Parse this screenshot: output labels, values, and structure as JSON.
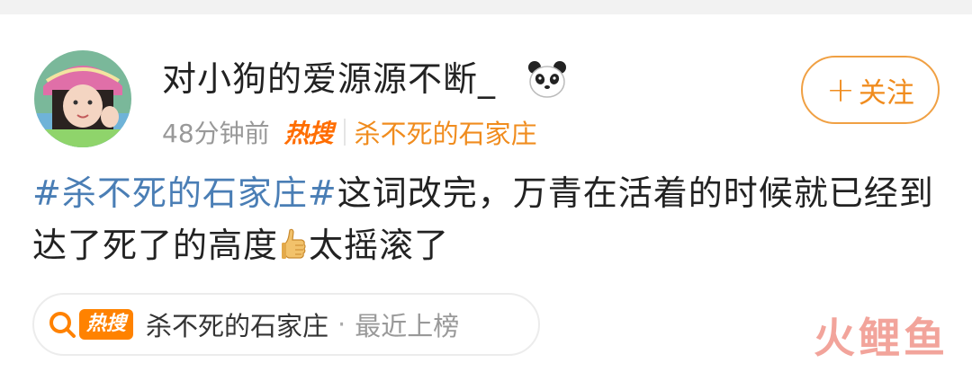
{
  "post": {
    "username": "对小狗的爱源源不断_",
    "username_emoji": "panda-icon",
    "follow_label": "关注",
    "follow_plus": "+",
    "time": "48分钟前",
    "hot_badge": "热搜",
    "topic_tag": "杀不死的石家庄",
    "hashtag": "#杀不死的石家庄#",
    "text_part1": "这词改完，万青在活着的时候就已经到达了死了的高度",
    "text_part2": "太摇滚了"
  },
  "card": {
    "hot_badge": "热搜",
    "topic": "杀不死的石家庄",
    "dot": "·",
    "status": "最近上榜"
  },
  "watermark": "火鲤鱼",
  "colors": {
    "accent_orange": "#f08c1e",
    "hashtag_blue": "#4a7eb5",
    "badge_orange": "#ff8200"
  }
}
